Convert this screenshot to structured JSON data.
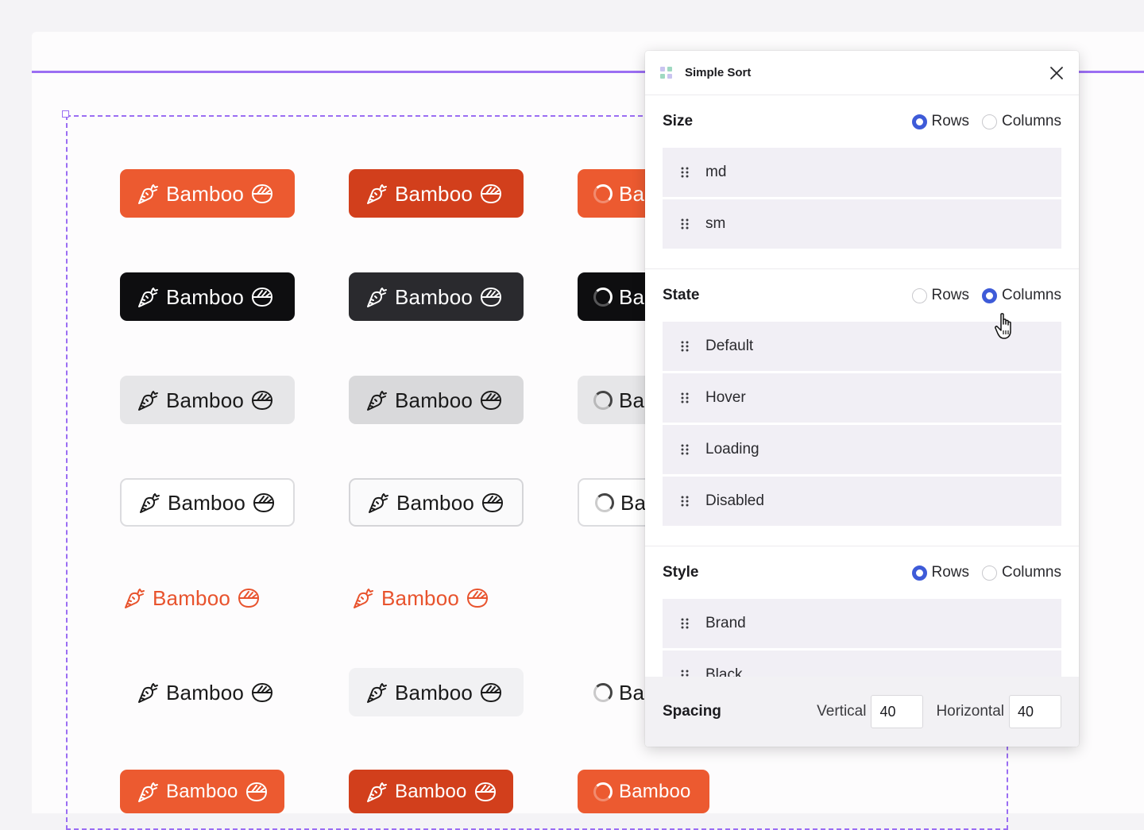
{
  "buttons": {
    "label": "Bamboo",
    "rows": [
      {
        "style": "brand",
        "cells": [
          "default",
          "hover",
          "loading"
        ]
      },
      {
        "style": "black",
        "cells": [
          "default",
          "hover",
          "loading"
        ]
      },
      {
        "style": "secondary",
        "cells": [
          "default",
          "hover",
          "loading"
        ]
      },
      {
        "style": "outline",
        "cells": [
          "default",
          "hover",
          "loading"
        ]
      },
      {
        "style": "link",
        "cells": [
          "default",
          "hover"
        ]
      },
      {
        "style": "ghost",
        "cells": [
          "default",
          "hover",
          "loading"
        ]
      },
      {
        "style": "brand-sm",
        "cells": [
          "default",
          "hover",
          "loading"
        ]
      }
    ]
  },
  "panel": {
    "title": "Simple Sort",
    "sections": [
      {
        "title": "Size",
        "rows_label": "Rows",
        "columns_label": "Columns",
        "selected": "Rows",
        "items": [
          "md",
          "sm"
        ]
      },
      {
        "title": "State",
        "rows_label": "Rows",
        "columns_label": "Columns",
        "selected": "Columns",
        "items": [
          "Default",
          "Hover",
          "Loading",
          "Disabled"
        ]
      },
      {
        "title": "Style",
        "rows_label": "Rows",
        "columns_label": "Columns",
        "selected": "Rows",
        "items": [
          "Brand",
          "Black"
        ]
      }
    ],
    "spacing": {
      "title": "Spacing",
      "vertical_label": "Vertical",
      "vertical_value": "40",
      "horizontal_label": "Horizontal",
      "horizontal_value": "40"
    }
  },
  "colors": {
    "brand": "#ec5a30",
    "brand_hover": "#d23f1c",
    "black": "#0e0e10",
    "accent": "#3e5bd8",
    "selection": "#9b6ef3"
  },
  "icons": {
    "leading": "carrot-icon",
    "trailing": "rice-bowl-icon",
    "close": "close-icon",
    "drag": "drag-handle-icon",
    "plugin": "grid-logo-icon",
    "cursor": "hand-pointer-icon"
  }
}
